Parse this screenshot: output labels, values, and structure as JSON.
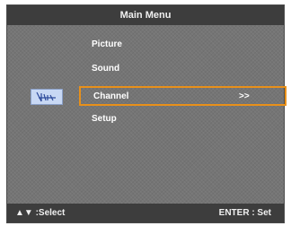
{
  "menu": {
    "title": "Main Menu",
    "items": [
      {
        "label": "Picture",
        "arrow": ""
      },
      {
        "label": "Sound",
        "arrow": ""
      },
      {
        "label": "Channel",
        "arrow": ">>"
      },
      {
        "label": "Setup",
        "arrow": ""
      }
    ],
    "selected_index": 2,
    "selected_icon": "antenna-icon",
    "highlight_color": "#e8901a"
  },
  "footer": {
    "select_icon": "up-down-arrows-icon",
    "select_glyph": "▲▼",
    "select_label": ":Select",
    "enter_label": "ENTER : Set"
  }
}
